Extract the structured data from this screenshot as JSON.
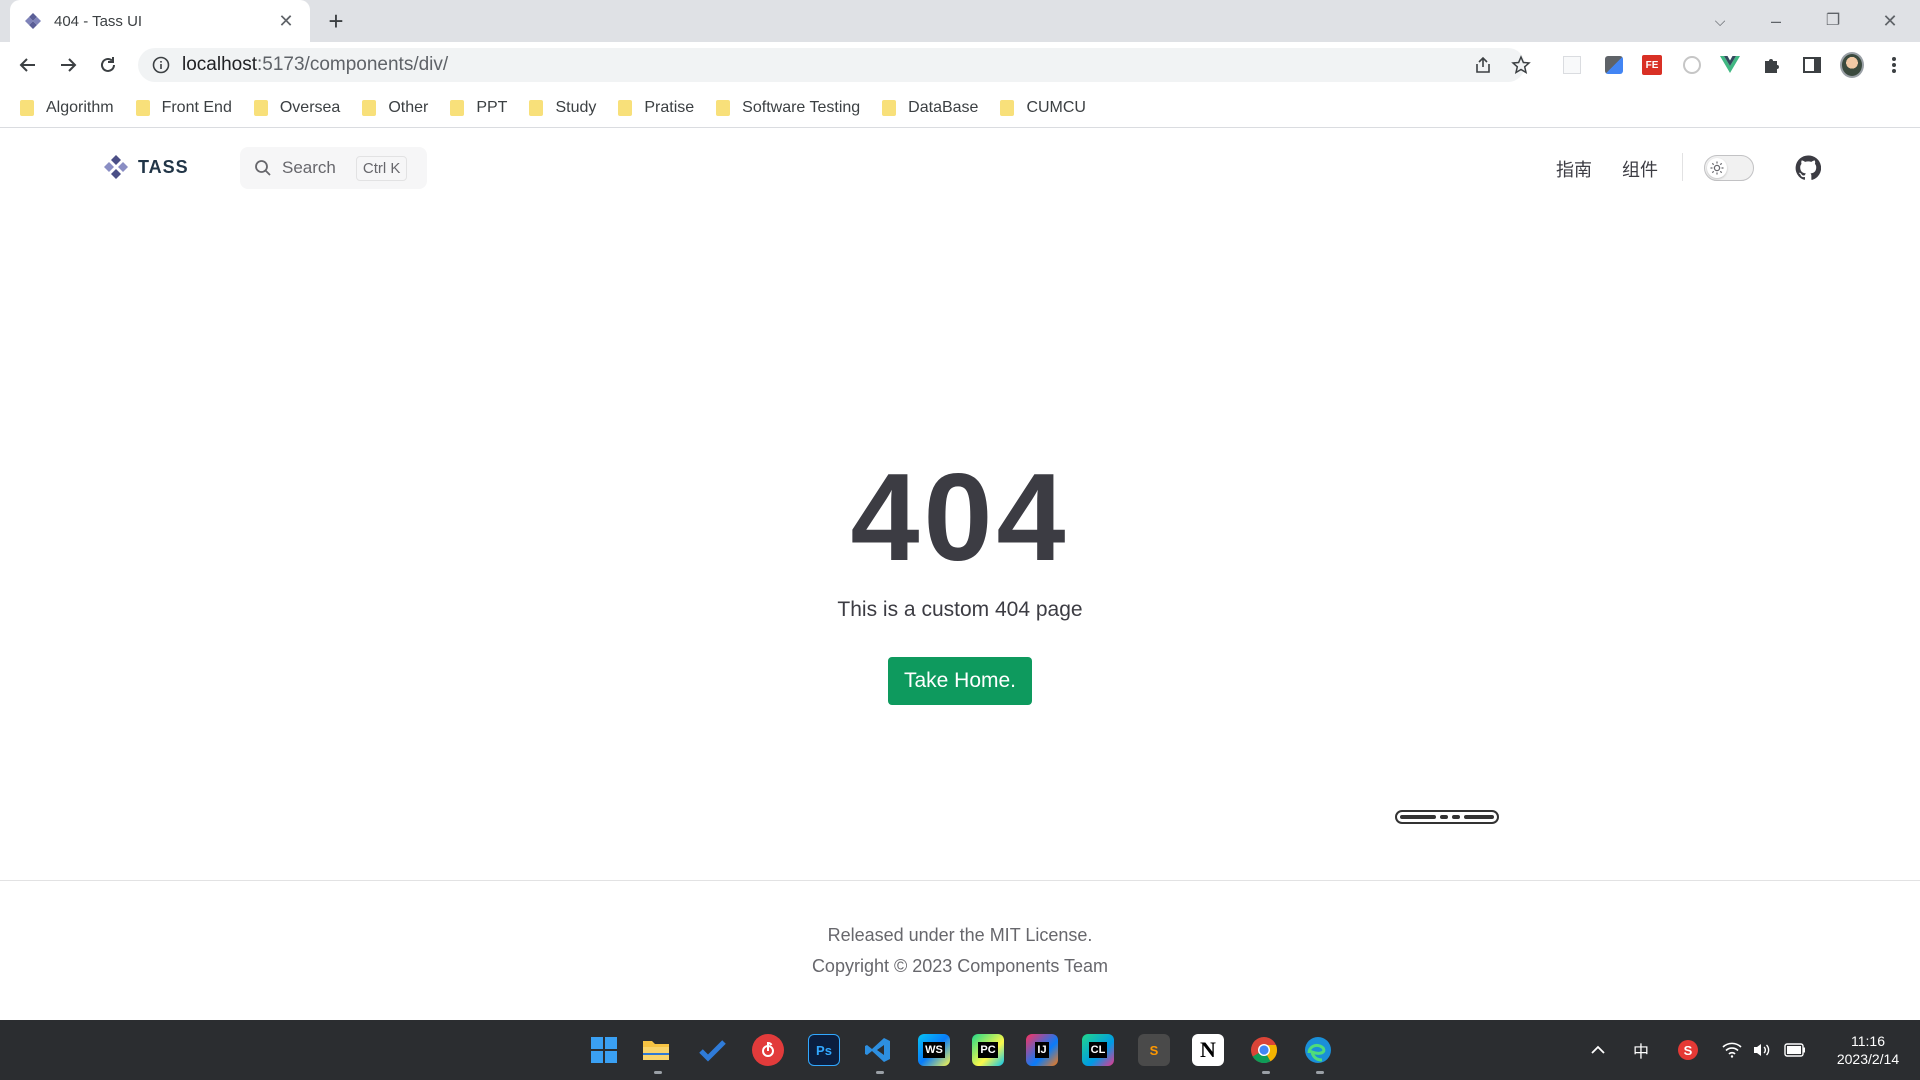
{
  "browser": {
    "tab_title": "404 - Tass UI",
    "url_host": "localhost",
    "url_path": ":5173/components/div/",
    "bookmarks": [
      {
        "label": "Algorithm"
      },
      {
        "label": "Front End"
      },
      {
        "label": "Oversea"
      },
      {
        "label": "Other"
      },
      {
        "label": "PPT"
      },
      {
        "label": "Study"
      },
      {
        "label": "Pratise"
      },
      {
        "label": "Software Testing"
      },
      {
        "label": "DataBase"
      },
      {
        "label": "CUMCU"
      }
    ]
  },
  "site": {
    "logo_text": "TASS",
    "search_placeholder": "Search",
    "search_shortcut": "Ctrl K",
    "nav": [
      "指南",
      "组件"
    ]
  },
  "not_found": {
    "code": "404",
    "message": "This is a custom 404 page",
    "button_label": "Take Home.",
    "button_color": "#0e9a5e"
  },
  "footer": {
    "license": "Released under the MIT License.",
    "copyright": "Copyright © 2023 Components Team"
  },
  "taskbar": {
    "ime": "中",
    "time": "11:16",
    "date": "2023/2/14",
    "apps": [
      "start-icon",
      "file-explorer-icon",
      "todo-icon",
      "netease-music-icon",
      "photoshop-icon",
      "vscode-icon",
      "webstorm-icon",
      "pycharm-icon",
      "intellij-icon",
      "clion-icon",
      "sublime-icon",
      "notion-icon",
      "chrome-icon",
      "edge-icon"
    ]
  }
}
